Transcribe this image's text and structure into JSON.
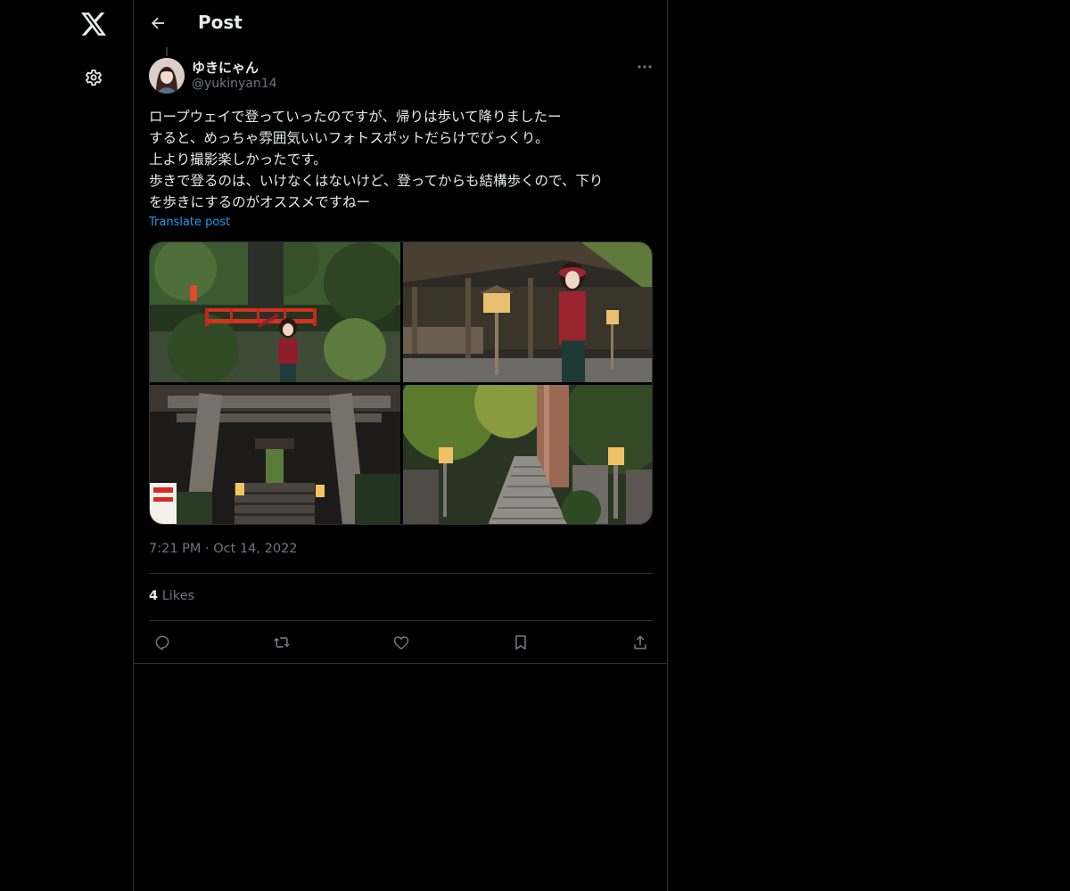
{
  "nav": {
    "logo_icon": "x-logo-icon",
    "settings_icon": "gear-icon"
  },
  "header": {
    "title": "Post",
    "back_icon": "arrow-left-icon"
  },
  "post": {
    "author_name": "ゆきにゃん",
    "author_handle": "@yukinyan14",
    "more_icon": "more-horizontal-icon",
    "text": "ロープウェイで登っていったのですが、帰りは歩いて降りましたー\nすると、めっちゃ雰囲気いいフォトスポットだらけでびっくり。\n上より撮影楽しかったです。\n歩きで登るのは、いけなくはないけど、登ってからも結構歩くので、下り\nを歩きにするのがオススメですねー",
    "translate_label": "Translate post",
    "time": "7:21 PM",
    "separator": "·",
    "date": "Oct 14, 2022",
    "likes_count": "4",
    "likes_label": "Likes",
    "photos": [
      {
        "name": "shrine-bridge-photo"
      },
      {
        "name": "shrine-hall-lanterns-photo"
      },
      {
        "name": "torii-gate-stairs-photo"
      },
      {
        "name": "stone-stairs-cedar-photo"
      }
    ]
  },
  "actions": [
    {
      "name": "reply-button",
      "icon": "reply-icon"
    },
    {
      "name": "repost-button",
      "icon": "repost-icon"
    },
    {
      "name": "like-button",
      "icon": "heart-icon"
    },
    {
      "name": "bookmark-button",
      "icon": "bookmark-icon"
    },
    {
      "name": "share-button",
      "icon": "share-icon"
    }
  ],
  "colors": {
    "background": "#000000",
    "text": "#e7e9ea",
    "muted": "#71767b",
    "accent": "#1d9bf0",
    "border": "#2f3336"
  }
}
